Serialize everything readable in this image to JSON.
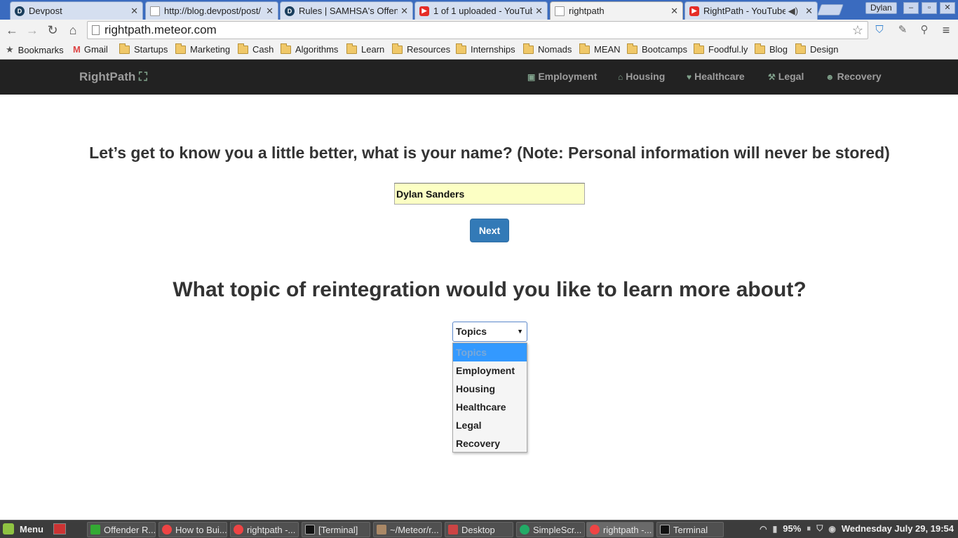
{
  "browser": {
    "tabs": [
      {
        "title": "Devpost",
        "icon": "devpost-icon"
      },
      {
        "title": "http://blog.devpost/post/",
        "icon": "page-icon"
      },
      {
        "title": "Rules | SAMHSA's Offen",
        "icon": "devpost-icon"
      },
      {
        "title": "1 of 1 uploaded - YouTub",
        "icon": "youtube-icon"
      },
      {
        "title": "rightpath",
        "icon": "page-icon"
      },
      {
        "title": "RightPath - YouTube",
        "icon": "youtube-icon"
      }
    ],
    "profile_name": "Dylan",
    "url": "rightpath.meteor.com",
    "bookmarks": [
      "Bookmarks",
      "Gmail",
      "Startups",
      "Marketing",
      "Cash",
      "Algorithms",
      "Learn",
      "Resources",
      "Internships",
      "Nomads",
      "MEAN",
      "Bootcamps",
      "Foodful.ly",
      "Blog",
      "Design"
    ]
  },
  "app": {
    "brand": "RightPath",
    "nav": [
      {
        "label": "Employment",
        "icon": "briefcase-icon"
      },
      {
        "label": "Housing",
        "icon": "home-icon"
      },
      {
        "label": "Healthcare",
        "icon": "heartbeat-icon"
      },
      {
        "label": "Legal",
        "icon": "gavel-icon"
      },
      {
        "label": "Recovery",
        "icon": "users-icon"
      }
    ],
    "name_question": "Let’s get to know you a little better, what is your name? (Note: Personal information will never be stored)",
    "name_value": "Dylan Sanders",
    "next_label": "Next",
    "topic_question": "What topic of reintegration would you like to learn more about?",
    "topic_select_value": "Topics",
    "topic_options": [
      "Topics",
      "Employment",
      "Housing",
      "Healthcare",
      "Legal",
      "Recovery"
    ],
    "colors": {
      "navbar": "#222222",
      "button": "#337ab7",
      "input_autofill": "#fcffc4",
      "highlight": "#3399ff"
    }
  },
  "taskbar": {
    "menu_label": "Menu",
    "items": [
      "Offender R...",
      "How to Bui...",
      "rightpath -...",
      "[Terminal]",
      "~/Meteor/r...",
      "Desktop",
      "SimpleScr...",
      "rightpath -...",
      "Terminal"
    ],
    "battery": "95%",
    "clock": "Wednesday July 29, 19:54"
  }
}
